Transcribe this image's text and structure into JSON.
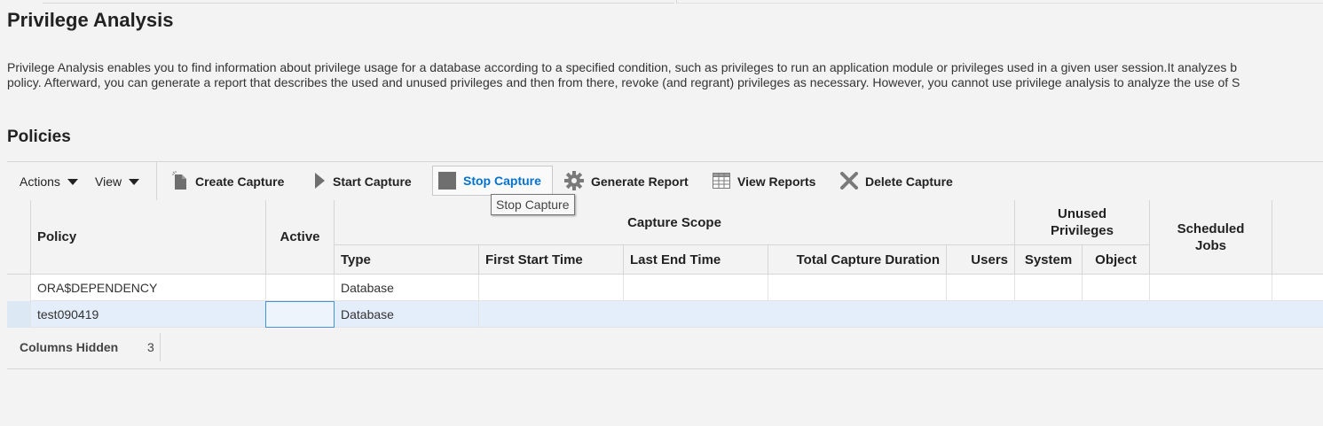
{
  "page": {
    "title": "Privilege Analysis",
    "description_line1": "Privilege Analysis enables you to find information about privilege usage for a database according to a specified condition, such as privileges to run an application module or privileges used in a given user session.It analyzes b",
    "description_line2": "policy. Afterward, you can generate a report that describes the used and unused privileges and then from there, revoke (and regrant) privileges as necessary. However, you cannot use privilege analysis to analyze the use of S",
    "section_title": "Policies"
  },
  "toolbar": {
    "actions_label": "Actions",
    "view_label": "View",
    "create_capture": "Create Capture",
    "start_capture": "Start Capture",
    "stop_capture": "Stop Capture",
    "generate_report": "Generate Report",
    "view_reports": "View Reports",
    "delete_capture": "Delete Capture",
    "tooltip": "Stop Capture",
    "icons": [
      "new-document-icon",
      "play-icon",
      "stop-icon",
      "gear-icon",
      "table-icon",
      "delete-x-icon"
    ]
  },
  "table": {
    "headers": {
      "policy": "Policy",
      "active": "Active",
      "capture_scope": "Capture Scope",
      "type": "Type",
      "first_start_time": "First Start Time",
      "last_end_time": "Last End Time",
      "total_capture_duration": "Total Capture Duration",
      "users": "Users",
      "unused_privileges_line1": "Unused",
      "unused_privileges_line2": "Privileges",
      "system": "System",
      "object": "Object",
      "scheduled_jobs_line1": "Scheduled",
      "scheduled_jobs_line2": "Jobs"
    },
    "rows": [
      {
        "policy": "ORA$DEPENDENCY",
        "active": "",
        "type": "Database"
      },
      {
        "policy": "test090419",
        "active": "",
        "type": "Database"
      }
    ]
  },
  "footer": {
    "columns_hidden_label": "Columns Hidden",
    "columns_hidden_count": "3"
  },
  "colors": {
    "link_blue": "#0572ce",
    "selected_row": "#e4eefa",
    "background": "#f3f3f3"
  }
}
